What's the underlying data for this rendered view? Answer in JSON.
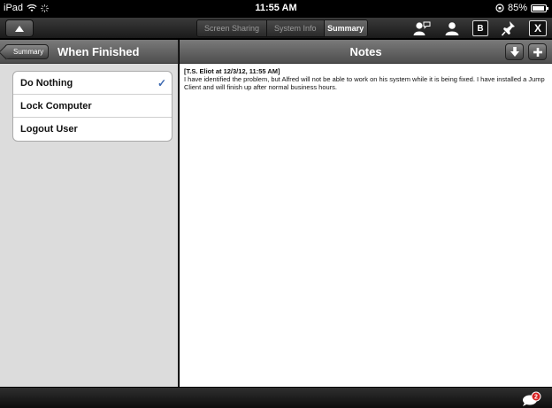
{
  "status": {
    "device": "iPad",
    "time": "11:55 AM",
    "battery": "85%"
  },
  "toolbar": {
    "tabs": [
      {
        "label": "Screen Sharing",
        "selected": false
      },
      {
        "label": "System Info",
        "selected": false
      },
      {
        "label": "Summary",
        "selected": true
      }
    ],
    "icons": [
      "user-chat-icon",
      "user-icon",
      "b-icon",
      "pin-icon",
      "x-icon"
    ],
    "b_label": "B",
    "x_label": "X"
  },
  "sidebar": {
    "back_label": "Summary",
    "title": "When Finished",
    "options": [
      {
        "label": "Do Nothing",
        "selected": true
      },
      {
        "label": "Lock Computer",
        "selected": false
      },
      {
        "label": "Logout User",
        "selected": false
      }
    ],
    "check_glyph": "✓"
  },
  "notes": {
    "title": "Notes",
    "entries": [
      {
        "author": "[T.S. Eliot at 12/3/12, 11:55 AM]",
        "text": "I have identified the problem, but Alfred will not be able to work on his system while it is being fixed. I have installed a Jump Client and will finish up after normal business hours."
      }
    ]
  },
  "bottom": {
    "chat_badge": "2"
  }
}
